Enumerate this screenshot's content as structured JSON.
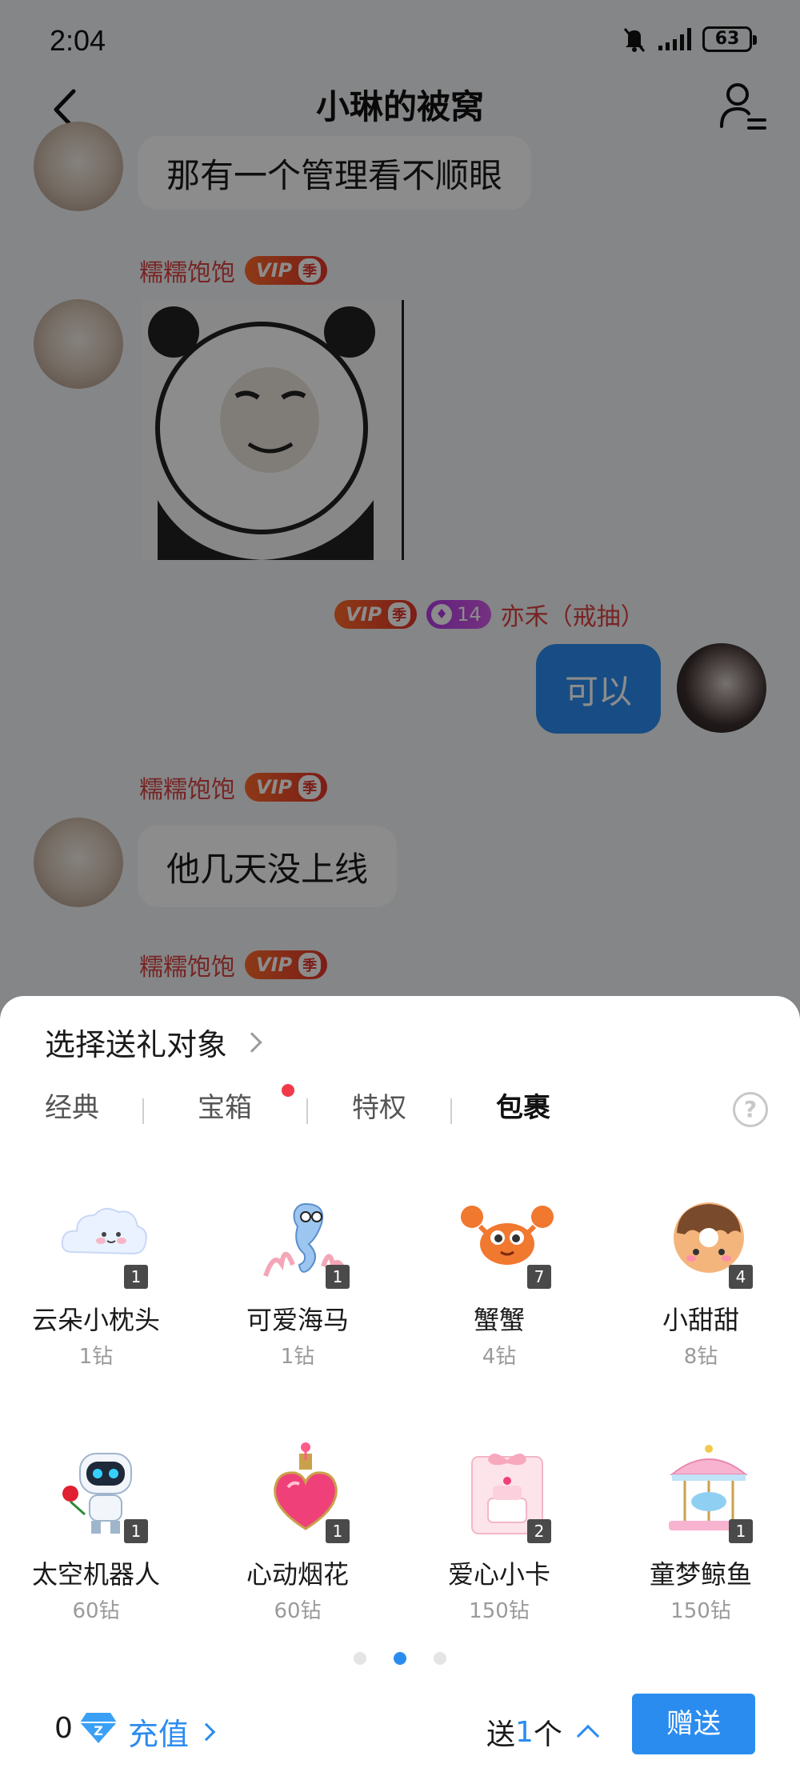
{
  "status_bar": {
    "time": "2:04",
    "battery": "63"
  },
  "header": {
    "title": "小琳的被窝"
  },
  "messages": [
    {
      "text": "那有一个管理看不顺眼"
    },
    {
      "sender": "糯糯饱饱",
      "vip": "VIP",
      "season": "季",
      "kind": "sticker"
    },
    {
      "sender": "亦禾（戒抽）",
      "vip": "VIP",
      "season": "季",
      "level": "14",
      "text": "可以"
    },
    {
      "sender": "糯糯饱饱",
      "vip": "VIP",
      "season": "季",
      "text": "他几天没上线"
    },
    {
      "sender": "糯糯饱饱",
      "vip": "VIP",
      "season": "季"
    }
  ],
  "gift_panel": {
    "target_label": "选择送礼对象",
    "tabs": [
      {
        "label": "经典"
      },
      {
        "label": "宝箱"
      },
      {
        "label": "特权"
      },
      {
        "label": "包裹"
      }
    ],
    "active_tab": "包裹",
    "help": "?",
    "gifts": [
      {
        "name": "云朵小枕头",
        "price": "1钻",
        "count": "1",
        "icon": "cloud-pillow-icon"
      },
      {
        "name": "可爱海马",
        "price": "1钻",
        "count": "1",
        "icon": "seahorse-icon"
      },
      {
        "name": "蟹蟹",
        "price": "4钻",
        "count": "7",
        "icon": "crab-icon"
      },
      {
        "name": "小甜甜",
        "price": "8钻",
        "count": "4",
        "icon": "donut-icon"
      },
      {
        "name": "太空机器人",
        "price": "60钻",
        "count": "1",
        "icon": "robot-icon"
      },
      {
        "name": "心动烟花",
        "price": "60钻",
        "count": "1",
        "icon": "heart-bottle-icon"
      },
      {
        "name": "爱心小卡",
        "price": "150钻",
        "count": "2",
        "icon": "cake-card-icon"
      },
      {
        "name": "童梦鲸鱼",
        "price": "150钻",
        "count": "1",
        "icon": "carousel-icon"
      }
    ],
    "page_indicator": {
      "total": 3,
      "current": 2
    },
    "balance": "0",
    "recharge_label": "充值",
    "quantity_prefix": "送",
    "quantity": "1",
    "quantity_unit": "个",
    "send_label": "赠送"
  },
  "colors": {
    "accent": "#2b8cf0",
    "sender_name": "#d94242",
    "vip": "#e2352a",
    "level": "#b33ae6"
  }
}
